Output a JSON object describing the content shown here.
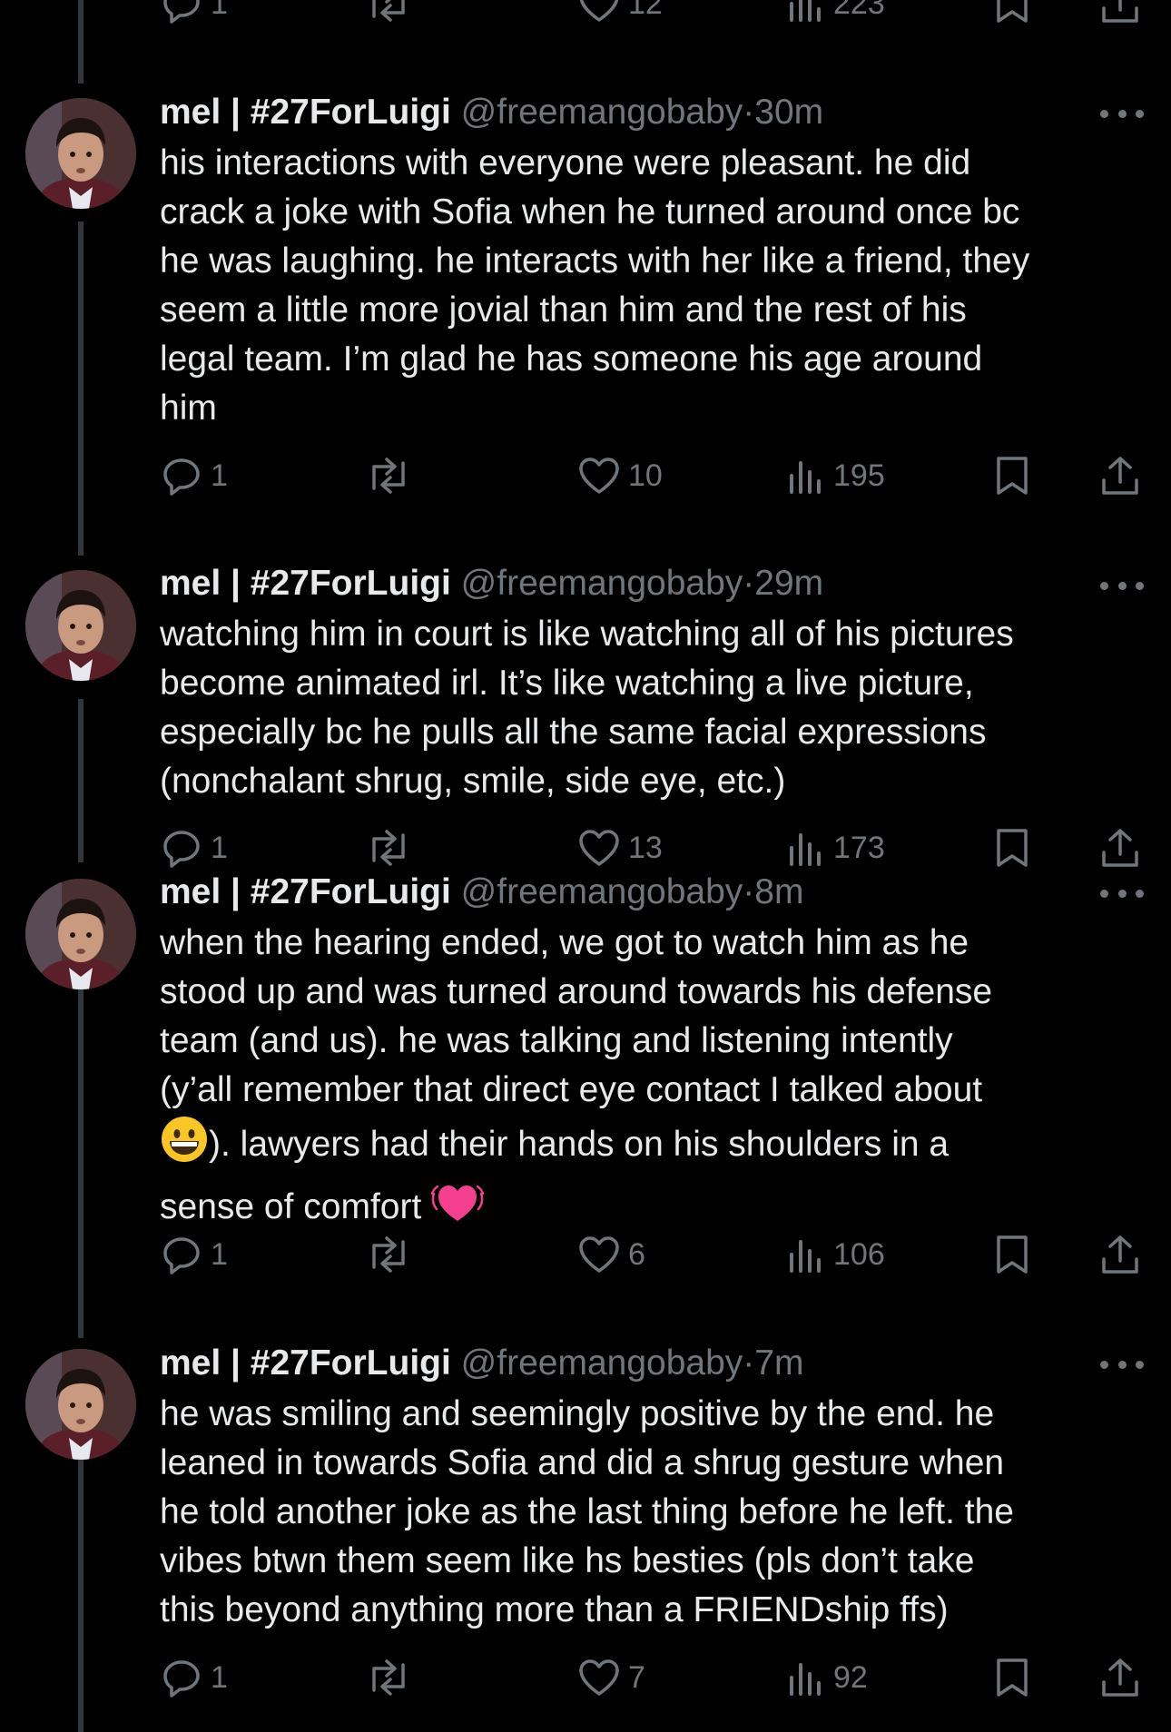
{
  "top_actions": {
    "replies": "1",
    "likes": "12",
    "views": "223"
  },
  "tweets": [
    {
      "name": "mel | #27ForLuigi",
      "handle": "@freemangobaby",
      "sep": "·",
      "time": "30m",
      "text": "his interactions with everyone were pleasant. he did\ncrack a joke with Sofia when he turned around once bc\nhe was laughing. he interacts with her like a friend, they\nseem a little more jovial than him and the rest of his\nlegal team. I’m glad he has someone his age around\nhim",
      "replies": "1",
      "likes": "10",
      "views": "195"
    },
    {
      "name": "mel | #27ForLuigi",
      "handle": "@freemangobaby",
      "sep": "·",
      "time": "29m",
      "text": "watching him in court is like watching all of his pictures\nbecome animated irl. It’s like watching a live picture,\nespecially bc he pulls all the same facial expressions\n(nonchalant shrug, smile, side eye, etc.)",
      "replies": "1",
      "likes": "13",
      "views": "173"
    },
    {
      "name": "mel | #27ForLuigi",
      "handle": "@freemangobaby",
      "sep": "·",
      "time": "8m",
      "text_a": "when the hearing ended, we got to watch him as he\nstood up and was turned around towards his defense\nteam (and us). he was talking and listening intently\n(y’all remember that direct eye contact I talked about\n",
      "emoji_1": "grinning-face-emoji",
      "text_b": "). lawyers had their hands on his shoulders in a\nsense of comfort ",
      "emoji_2": "beating-heart-emoji",
      "replies": "1",
      "likes": "6",
      "views": "106"
    },
    {
      "name": "mel | #27ForLuigi",
      "handle": "@freemangobaby",
      "sep": "·",
      "time": "7m",
      "text": "he was smiling and seemingly positive by the end. he\nleaned in towards Sofia and did a shrug gesture when\nhe told another joke as the last thing before he left. the\nvibes btwn them seem like hs besties (pls don’t take\nthis beyond anything more than a FRIENDship ffs)",
      "replies": "1",
      "likes": "7",
      "views": "92"
    }
  ],
  "colors": {
    "background": "#000000",
    "text": "#e7e9ea",
    "muted": "#71767b",
    "thread_line": "#333639"
  }
}
